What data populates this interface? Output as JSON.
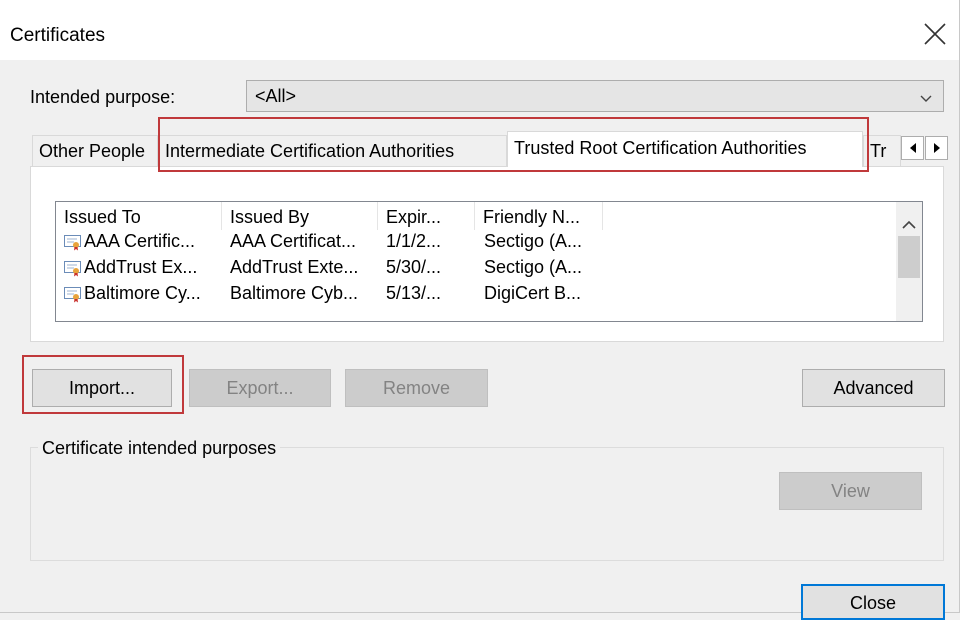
{
  "window": {
    "title": "Certificates"
  },
  "purpose": {
    "label": "Intended purpose:",
    "value": "<All>"
  },
  "tabs": [
    {
      "label": "Other People",
      "active": false
    },
    {
      "label": "Intermediate Certification Authorities",
      "active": false
    },
    {
      "label": "Trusted Root Certification Authorities",
      "active": true
    },
    {
      "label": "Tr",
      "active": false
    }
  ],
  "list": {
    "columns": [
      "Issued To",
      "Issued By",
      "Expir...",
      "Friendly N..."
    ],
    "rows": [
      [
        "AAA Certific...",
        "AAA Certificat...",
        "1/1/2...",
        "Sectigo (A..."
      ],
      [
        "AddTrust Ex...",
        "AddTrust Exte...",
        "5/30/...",
        "Sectigo (A..."
      ],
      [
        "Baltimore Cy...",
        "Baltimore Cyb...",
        "5/13/...",
        "DigiCert B..."
      ]
    ]
  },
  "buttons": {
    "import": "Import...",
    "export": "Export...",
    "remove": "Remove",
    "advanced": "Advanced",
    "view": "View",
    "close": "Close"
  },
  "purposes_group": {
    "title": "Certificate intended purposes"
  },
  "icons": {
    "close": "close-icon",
    "chevron": "chevron-down-icon",
    "tab_left": "arrow-left-icon",
    "tab_right": "arrow-right-icon",
    "certificate": "certificate-icon",
    "scroll_up": "scroll-up-icon"
  },
  "colors": {
    "highlight": "#c0393b",
    "default_button_border": "#0078d7"
  }
}
